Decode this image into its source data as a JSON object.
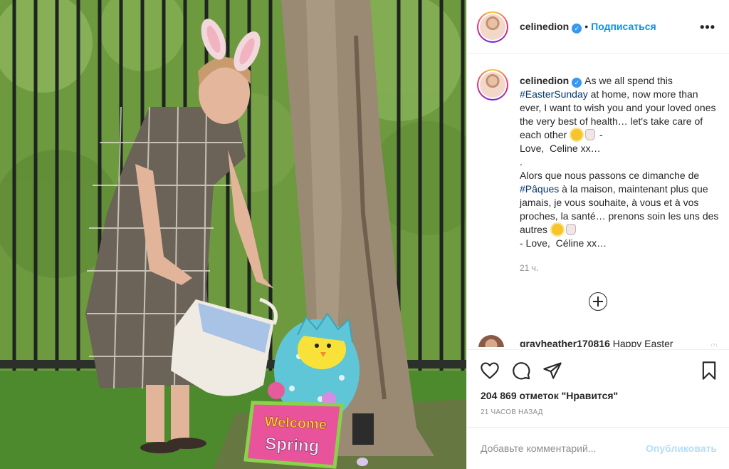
{
  "post": {
    "username": "celinedion",
    "verified_glyph": "✓",
    "separator": "•",
    "follow_label": "Подписаться",
    "more_label": "•••",
    "caption": {
      "line_en_1": "As we all spend this ",
      "tag_en": "#EasterSunday",
      "line_en_2": " at home, now more than ever, I want to wish you and your loved ones the very best of health… let's take care of each other ",
      "line_en_3": " -",
      "line_en_4": "Love,  Celine xx…",
      "dot_line": ".",
      "line_fr_1": "Alors que nous passons ce dimanche de ",
      "tag_fr": "#Pâques",
      "line_fr_2": " à la maison, maintenant plus que jamais, je vous souhaite, à vous et à vos proches, la santé… prenons soin les uns des autres ",
      "line_fr_3": "- Love,  Céline xx…"
    },
    "time_ago_short": "21 ч.",
    "first_comment": {
      "username": "grayheather170816",
      "text": " Happy Easter"
    },
    "likes_text": "204 869 отметок \"Нравится\"",
    "time_ago_long": "21 ЧАСОВ НАЗАД",
    "add_comment_placeholder": "Добавьте комментарий...",
    "publish_label": "Опубликовать"
  },
  "photo": {
    "sign_line_1": "Welcome",
    "sign_line_2": "Spring"
  },
  "icons": {
    "like": "heart-icon",
    "comment": "comment-icon",
    "share": "paper-plane-icon",
    "save": "bookmark-icon",
    "load_more": "plus-circle-icon"
  },
  "colors": {
    "link": "#0095f6",
    "hashtag": "#00376b",
    "muted": "#8e8e8e",
    "publish_disabled": "#b2dffc"
  }
}
